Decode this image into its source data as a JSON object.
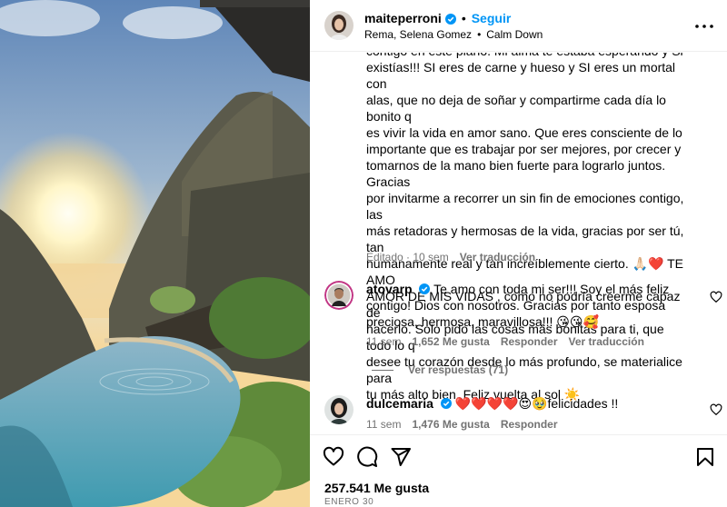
{
  "post": {
    "username": "maiteperroni",
    "follow_label": "Seguir",
    "audio_artists": "Rema, Selena Gomez",
    "audio_track": "Calm Down",
    "caption_text": "contigo en este plano. Mi alma te estaba esperando y Si\nexistías!!! SI eres de carne y hueso y SI eres un mortal con\nalas, que no deja de soñar y compartirme cada día lo bonito q\nes vivir la vida en amor sano. Que eres consciente de lo\nimportante que es trabajar por ser mejores, por crecer y\ntomarnos de la mano bien fuerte para lograrlo juntos. Gracias\npor invitarme a recorrer un sin fin de emociones contigo, las\nmás retadoras y hermosas de la vida, gracias por ser tú, tan\nhumanamente real y tan increíblemente cierto. 🙏🏻❤️ TE AMO\nAMOR DE MIS VIDAS , como no podría creerme capaz de\nhacerlo. Solo pido las cosas más bonitas para ti, que todo lo q\ndesee tu corazón desde lo más profundo, se materialice para\ntu más alto bien. Feliz vuelta al sol ☀️",
    "caption_edited": "Editado · 10 sem",
    "caption_translate": "Ver traducción",
    "likes": "257.541 Me gusta",
    "date": "ENERO 30"
  },
  "comments": [
    {
      "username": "atovarp",
      "text": "Te amo con toda mi ser!!! Soy el más feliz contigo! Dios con nosotros. Gracias por tanto esposa preciosa, hermosa, maravillosa!!! 😘😘🥰",
      "time": "11 sem",
      "likes": "1,652 Me gusta",
      "reply": "Responder",
      "translate": "Ver traducción",
      "view_replies": "Ver respuestas (71)"
    },
    {
      "username": "dulcemaria",
      "text": "❤️❤️❤️❤️😍🥹felicidades !!",
      "time": "11 sem",
      "likes": "1,476 Me gusta",
      "reply": "Responder"
    }
  ],
  "colors": {
    "accent": "#0095f6",
    "secondary_text": "#737373",
    "verified": "#0095f6"
  },
  "icons": [
    "more-icon",
    "verified-badge-icon",
    "like-icon",
    "comment-icon",
    "share-icon",
    "save-icon",
    "heart-small-icon"
  ]
}
